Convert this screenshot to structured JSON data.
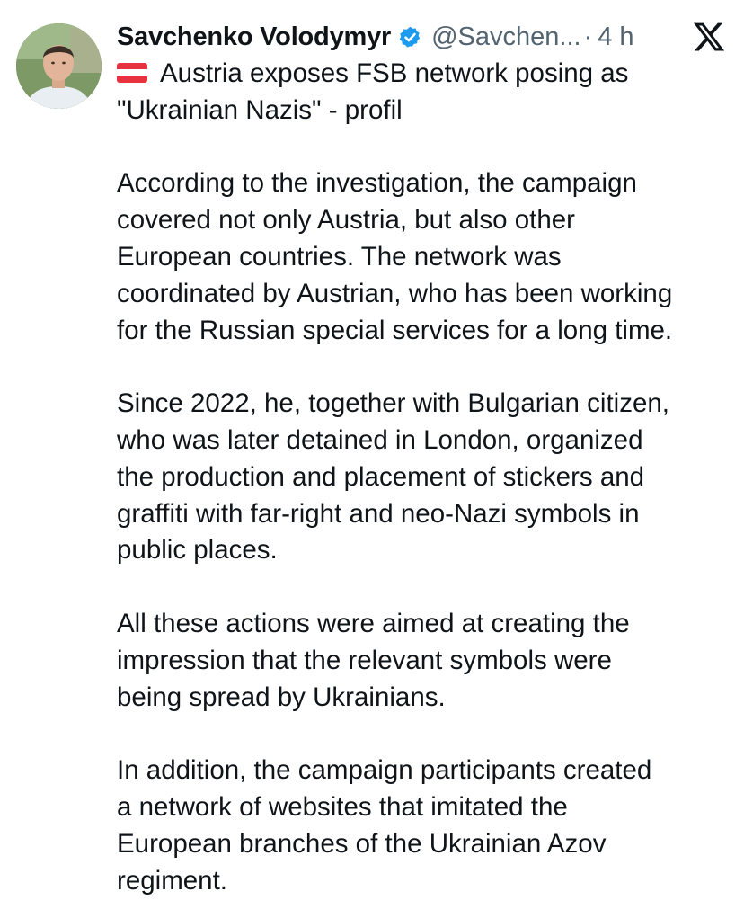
{
  "tweet": {
    "author_name": "Savchenko Volodymyr",
    "handle": "@Savchen...",
    "separator": "·",
    "time": "4 h",
    "icons": {
      "verified": "verified-badge-icon",
      "platform": "x-logo-icon",
      "flag": "austria-flag-icon"
    },
    "colors": {
      "text": "#0f1419",
      "secondary": "#536471",
      "verified": "#1d9bf0"
    },
    "headline_lines": [
      "Austria exposes FSB network posing as",
      "\"Ukrainian Nazis\" - profil"
    ],
    "paragraphs": [
      [
        "According to the investigation, the campaign",
        "covered not only Austria, but also other",
        "European countries. The network was",
        "coordinated by Austrian, who has been working",
        "for the Russian special services for a long time."
      ],
      [
        "Since 2022, he, together with Bulgarian citizen,",
        "who was later detained in London, organized",
        "the production and placement of stickers and",
        "graffiti with far-right and neo-Nazi symbols in",
        "public places."
      ],
      [
        "All these actions were aimed at creating the",
        "impression that the relevant symbols were",
        "being spread by Ukrainians."
      ],
      [
        "In addition, the campaign participants created",
        "a network of websites that imitated the",
        "European branches of the Ukrainian Azov",
        "regiment."
      ]
    ]
  }
}
